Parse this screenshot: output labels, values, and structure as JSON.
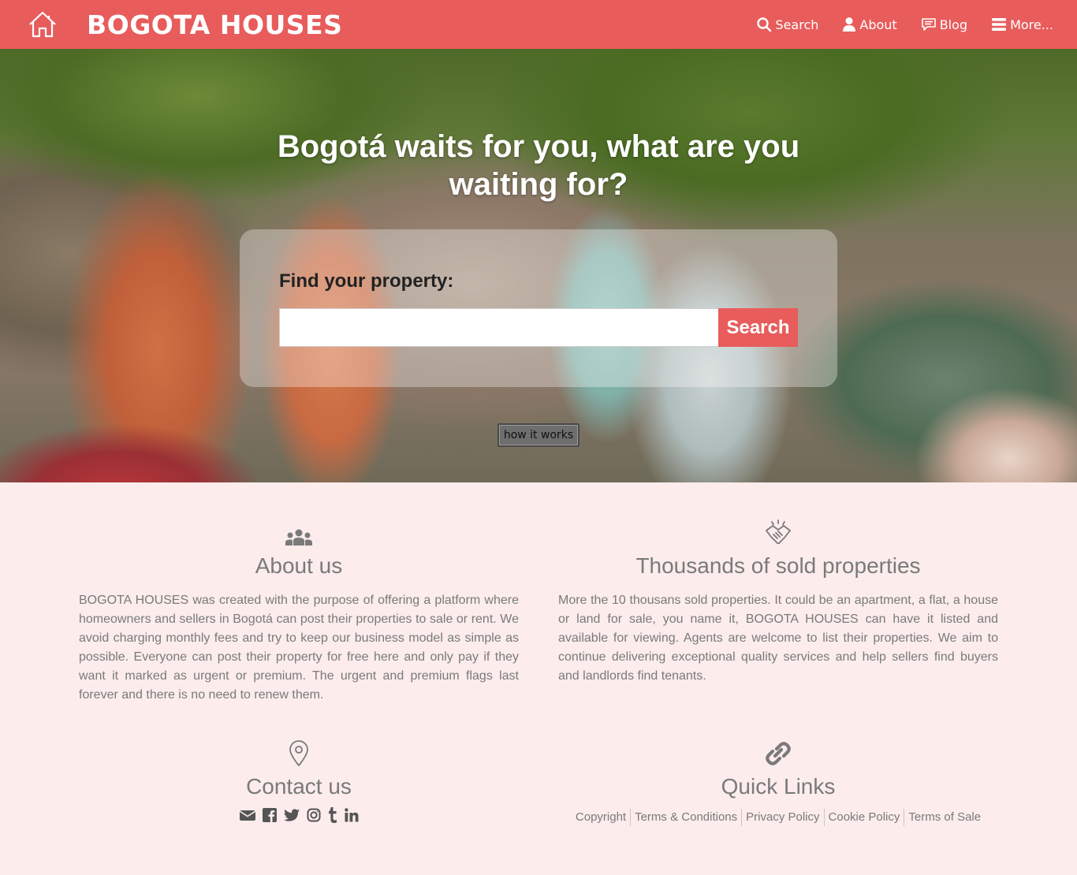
{
  "colors": {
    "accent": "#e85c5c",
    "background": "#fcecec",
    "text": "#7a7a7a"
  },
  "navbar": {
    "brand": "BOGOTA HOUSES",
    "home_icon": "home-icon",
    "links": [
      {
        "label": "Search",
        "icon": "search-icon"
      },
      {
        "label": "About",
        "icon": "user-icon"
      },
      {
        "label": "Blog",
        "icon": "chat-icon"
      },
      {
        "label": "More...",
        "icon": "menu-icon"
      }
    ]
  },
  "hero": {
    "title": "Bogotá waits for you, what are you waiting for?",
    "search_label": "Find your property:",
    "search_value": "",
    "search_button": "Search",
    "how_button": "how it works"
  },
  "about": {
    "icon": "users-icon",
    "title": "About us",
    "text": "BOGOTA HOUSES was created with the purpose of offering a platform where homeowners and sellers in Bogotá can post their properties to sale or rent. We avoid charging monthly fees and try to keep our business model as simple as possible. Everyone can post their property for free here and only pay if they want it marked as urgent or premium. The urgent and premium flags last forever and there is no need to renew them."
  },
  "sold": {
    "icon": "handshake-icon",
    "title": "Thousands of sold properties",
    "text": "More the 10 thousans sold properties. It could be an apartment, a flat, a house or land for sale, you name it, BOGOTA HOUSES can have it listed and available for viewing. Agents are welcome to list their properties. We aim to continue delivering exceptional quality services and help sellers find buyers and landlords find tenants."
  },
  "contact": {
    "icon": "map-pin-icon",
    "title": "Contact us",
    "social": [
      "envelope-icon",
      "facebook-icon",
      "twitter-icon",
      "instagram-icon",
      "tumblr-icon",
      "linkedin-icon"
    ]
  },
  "quick_links": {
    "icon": "link-icon",
    "title": "Quick Links",
    "items": [
      "Copyright",
      "Terms & Conditions",
      "Privacy Policy",
      "Cookie Policy",
      "Terms of Sale"
    ]
  }
}
